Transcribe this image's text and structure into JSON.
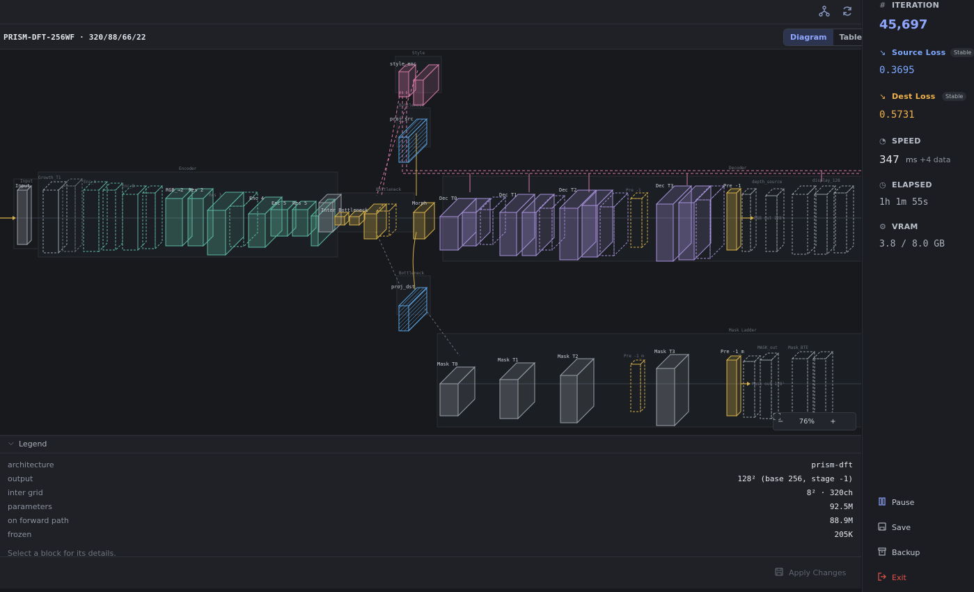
{
  "model_title": "PRISM-DFT-256WF · 320/88/66/22",
  "view_toggle": {
    "diagram": "Diagram",
    "table": "Table",
    "active": "diagram"
  },
  "toolbar_icons": [
    "graph-icon",
    "refresh-icon"
  ],
  "diagram": {
    "groups": {
      "style": "Style",
      "bottleneck_top": "Bottleneck",
      "encoder": "Encoder",
      "bottleneck_mid": "Bottleneck",
      "decoder": "Decoder",
      "bottleneck_bottom": "Bottleneck",
      "mask_ladder": "Mask Ladder",
      "input": "Input"
    },
    "blocks": {
      "input": "Input",
      "growth": "Growth_T1",
      "enc_a": "Enc_A",
      "enc_b": "Enc_B",
      "rgb": "RGB_→2",
      "res2": "Res 2",
      "res3": "Res 3",
      "enc4": "Enc 4",
      "enc5": "Enc 5",
      "res5": "Res 5",
      "inter": "Inter Bottleneck",
      "morph": "Morph",
      "style": "style_enc",
      "proj_top": "proj_src",
      "proj_bottom": "proj_dst",
      "dec_t0": "Dec T0",
      "dec_t1": "Dec T1",
      "dec_t2": "Dec T2",
      "pre_dashed": "Pre -1",
      "dec_t3": "Dec T3",
      "pre_gold": "Pre -1",
      "rgb_out": "RGB out 128²",
      "depth": "depth_source",
      "disp": "display_128",
      "mask_t0": "Mask T0",
      "mask_t1": "Mask T1",
      "mask_t2": "Mask T2",
      "pre_m_dashed": "Pre -1_m",
      "mask_t3": "Mask T3",
      "pre_m_gold": "Pre -1_m",
      "mask_out": "Mask out 128²",
      "mask_out_a": "MASK_out",
      "mask_out_b": "Mask_BTE"
    }
  },
  "zoom": {
    "minus": "−",
    "level": "76%",
    "plus": "+"
  },
  "legend": {
    "title": "Legend",
    "rows": [
      {
        "key": "architecture",
        "value": "prism-dft"
      },
      {
        "key": "output",
        "value": "128² (base 256, stage -1)"
      },
      {
        "key": "inter grid",
        "value": "8² · 320ch"
      },
      {
        "key": "parameters",
        "value": "92.5M"
      },
      {
        "key": "on forward path",
        "value": "88.9M"
      },
      {
        "key": "frozen",
        "value": "205K"
      }
    ],
    "hint": "Select a block for its details."
  },
  "apply_label": "Apply Changes",
  "sidebar": {
    "iteration": {
      "label": "ITERATION",
      "value": "45,697"
    },
    "source_loss": {
      "label": "Source Loss",
      "badge": "Stable",
      "value": "0.3695"
    },
    "dest_loss": {
      "label": "Dest Loss",
      "badge": "Stable",
      "value": "0.5731"
    },
    "speed": {
      "label": "SPEED",
      "value": "347",
      "unit": "ms",
      "extra": "+4 data"
    },
    "elapsed": {
      "label": "ELAPSED",
      "value": "1h 1m 55s"
    },
    "vram": {
      "label": "VRAM",
      "value": "3.8 / 8.0 GB"
    },
    "actions": {
      "pause": "Pause",
      "save": "Save",
      "backup": "Backup",
      "exit": "Exit"
    }
  },
  "colors": {
    "accent": "#8fa6ff",
    "source_loss": "#7fa8ff",
    "dest_loss": "#f0b24a",
    "exit": "#e5534b",
    "encoder": "#5bb8a0",
    "bottleneck": "#d8b24a",
    "decoder": "#a591d9",
    "style": "#d77aa8",
    "proj": "#5ca3e0",
    "mask": "#9aa0aa"
  }
}
